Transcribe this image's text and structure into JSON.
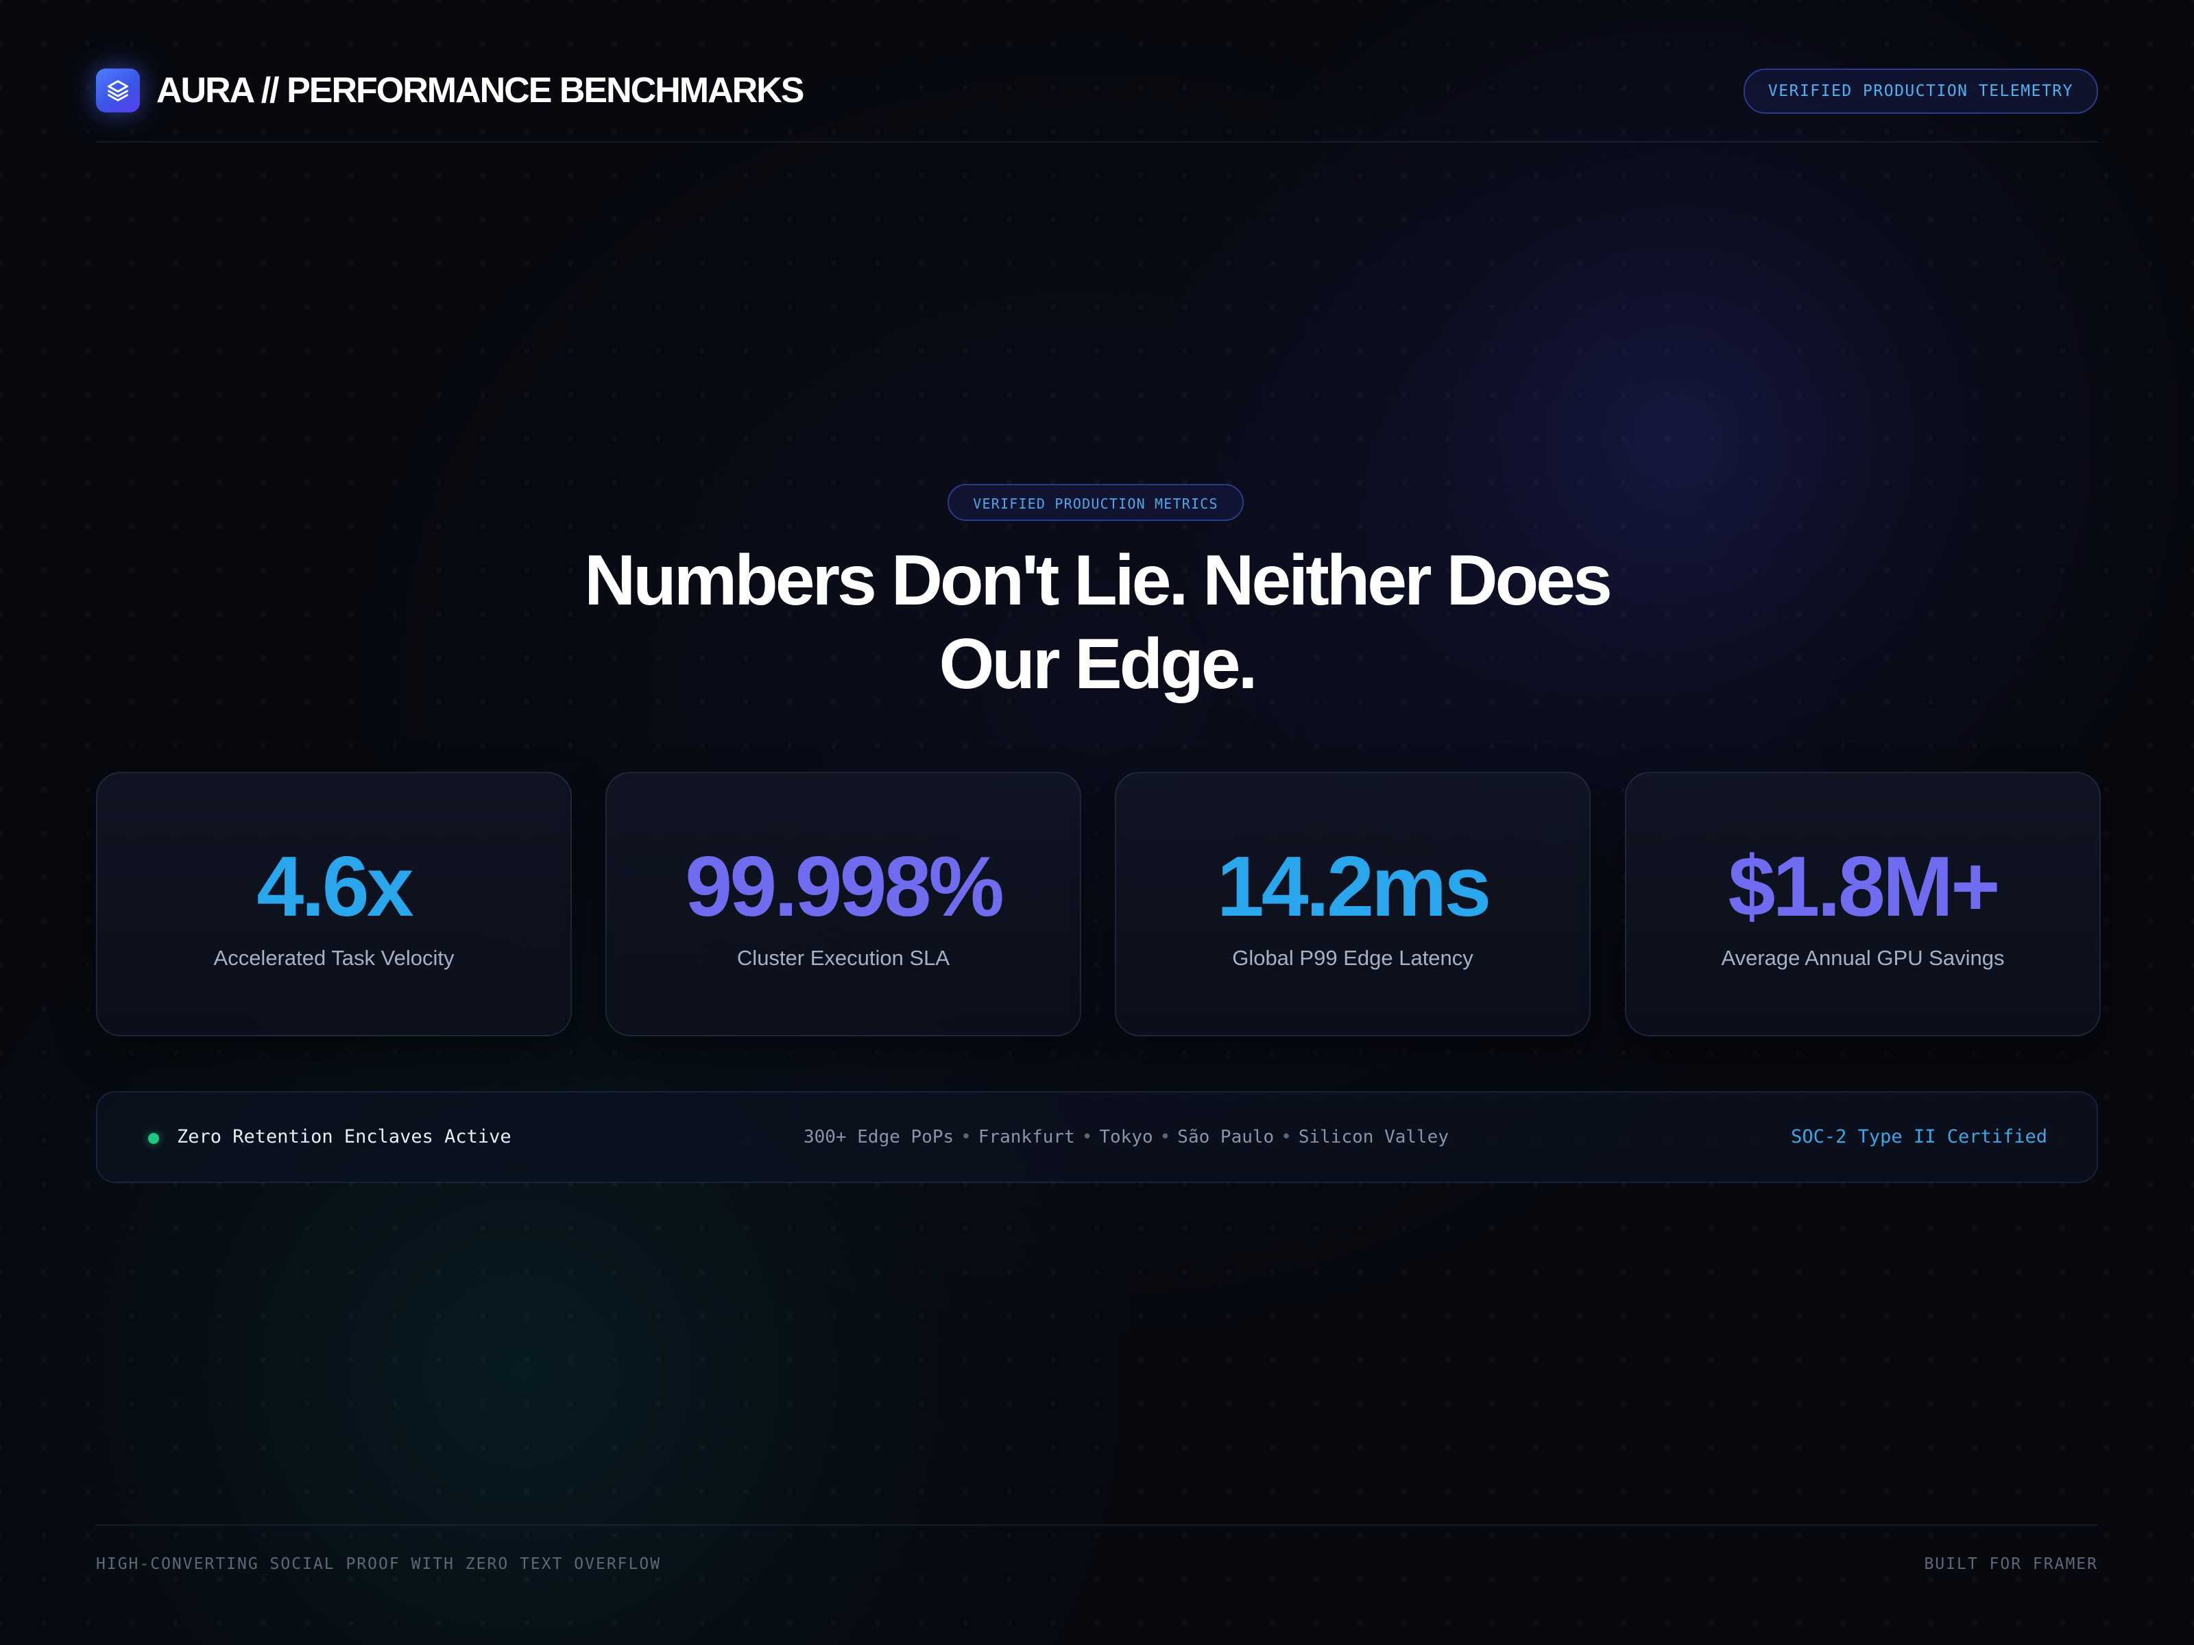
{
  "header": {
    "title": "AURA // PERFORMANCE BENCHMARKS",
    "logo_icon": "layers-icon",
    "badge": "VERIFIED PRODUCTION TELEMETRY"
  },
  "hero": {
    "badge": "VERIFIED PRODUCTION METRICS",
    "title_line1": "Numbers Don't Lie. Neither Does",
    "title_line2": "Our Edge."
  },
  "stats": [
    {
      "value": "4.6x",
      "label": "Accelerated Task Velocity",
      "color": "#2aa7ec"
    },
    {
      "value": "99.998%",
      "label": "Cluster Execution SLA",
      "color": "#6f6cf0"
    },
    {
      "value": "14.2ms",
      "label": "Global P99 Edge Latency",
      "color": "#2aa7ec"
    },
    {
      "value": "$1.8M+",
      "label": "Average Annual GPU Savings",
      "color": "#6f6cf0"
    }
  ],
  "status": {
    "left": "Zero Retention Enclaves Active",
    "indicator_color": "#1fc784",
    "locations": [
      "300+ Edge PoPs",
      "Frankfurt",
      "Tokyo",
      "São Paulo",
      "Silicon Valley"
    ],
    "separator": "•",
    "right": "SOC-2 Type II Certified"
  },
  "footer": {
    "left": "HIGH-CONVERTING SOCIAL PROOF WITH ZERO TEXT OVERFLOW",
    "right": "BUILT FOR FRAMER"
  },
  "colors": {
    "background": "#07090f",
    "accent_blue": "#2aa7ec",
    "accent_violet": "#6f6cf0",
    "badge_text": "#4fb2f0"
  }
}
